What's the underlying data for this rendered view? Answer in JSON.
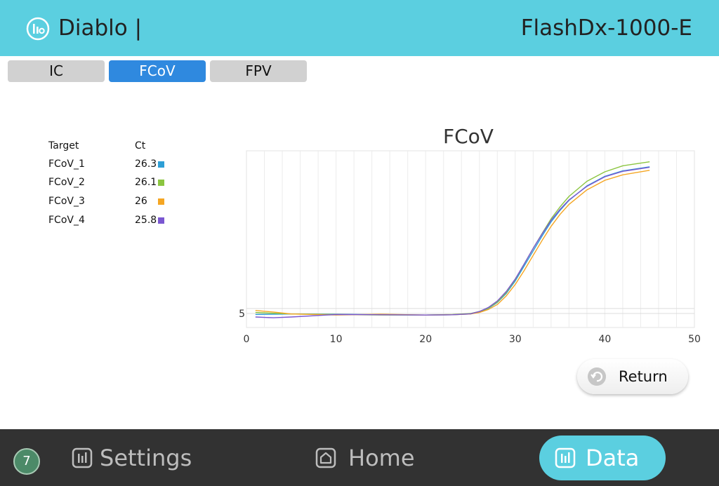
{
  "header": {
    "app_name": "Diablo |",
    "device_name": "FlashDx-1000-E",
    "logo_icon": "bar-chart-circle-icon"
  },
  "tabs": [
    {
      "label": "IC",
      "active": false
    },
    {
      "label": "FCoV",
      "active": true
    },
    {
      "label": "FPV",
      "active": false
    }
  ],
  "targets": {
    "header_target": "Target",
    "header_ct": "Ct",
    "rows": [
      {
        "name": "FCoV_1",
        "ct": "26.3",
        "color": "#2d9fd6"
      },
      {
        "name": "FCoV_2",
        "ct": "26.1",
        "color": "#8bc540"
      },
      {
        "name": "FCoV_3",
        "ct": "26",
        "color": "#f5a623"
      },
      {
        "name": "FCoV_4",
        "ct": "25.8",
        "color": "#7a57d1"
      }
    ]
  },
  "chart_data": {
    "type": "line",
    "title": "FCoV",
    "xlabel": "",
    "ylabel": "",
    "xlim": [
      0,
      50
    ],
    "x_ticks": [
      "0",
      "10",
      "20",
      "30",
      "40",
      "50"
    ],
    "y_ticks": [
      "5"
    ],
    "grid": true,
    "series": [
      {
        "color": "#2d9fd6",
        "x": [
          1,
          5,
          10,
          15,
          20,
          23,
          25,
          26,
          27,
          28,
          29,
          30,
          31,
          32,
          33,
          34,
          35,
          36,
          38,
          40,
          42,
          45
        ],
        "y": [
          4.8,
          4.9,
          4.85,
          4.75,
          4.7,
          4.75,
          4.9,
          5.3,
          6.0,
          7.2,
          9.0,
          11.5,
          14.5,
          17.5,
          20.5,
          23.3,
          25.6,
          27.6,
          30.5,
          32.4,
          33.5,
          34.3
        ]
      },
      {
        "color": "#8bc540",
        "x": [
          1,
          5,
          10,
          15,
          20,
          23,
          25,
          26,
          27,
          28,
          29,
          30,
          31,
          32,
          33,
          34,
          35,
          36,
          38,
          40,
          42,
          45
        ],
        "y": [
          5.2,
          4.9,
          4.8,
          4.7,
          4.7,
          4.8,
          5.0,
          5.4,
          6.1,
          7.3,
          9.2,
          11.8,
          14.9,
          18.0,
          21.0,
          23.9,
          26.3,
          28.4,
          31.4,
          33.3,
          34.5,
          35.3
        ]
      },
      {
        "color": "#f5a623",
        "x": [
          1,
          3,
          5,
          10,
          15,
          20,
          23,
          25,
          26,
          27,
          28,
          29,
          30,
          31,
          32,
          33,
          34,
          35,
          36,
          38,
          40,
          42,
          45
        ],
        "y": [
          5.6,
          5.3,
          4.9,
          4.7,
          4.85,
          4.7,
          4.75,
          4.9,
          5.2,
          5.8,
          6.8,
          8.5,
          10.8,
          13.6,
          16.6,
          19.6,
          22.4,
          24.8,
          26.8,
          29.7,
          31.6,
          32.7,
          33.6
        ]
      },
      {
        "color": "#7a57d1",
        "x": [
          1,
          3,
          5,
          10,
          15,
          20,
          23,
          25,
          26,
          27,
          28,
          29,
          30,
          31,
          32,
          33,
          34,
          35,
          36,
          38,
          40,
          42,
          45
        ],
        "y": [
          4.3,
          4.15,
          4.3,
          4.8,
          4.75,
          4.7,
          4.75,
          4.95,
          5.4,
          6.2,
          7.5,
          9.4,
          11.9,
          14.9,
          18.0,
          20.9,
          23.6,
          25.8,
          27.7,
          30.4,
          32.3,
          33.4,
          34.2
        ]
      }
    ]
  },
  "return_button": {
    "label": "Return",
    "icon": "return-arrow-icon"
  },
  "footer": {
    "badge_count": "7",
    "settings_label": "Settings",
    "settings_icon": "bar-chart-icon",
    "home_label": "Home",
    "home_icon": "home-icon",
    "data_label": "Data",
    "data_icon": "bar-chart-icon"
  }
}
